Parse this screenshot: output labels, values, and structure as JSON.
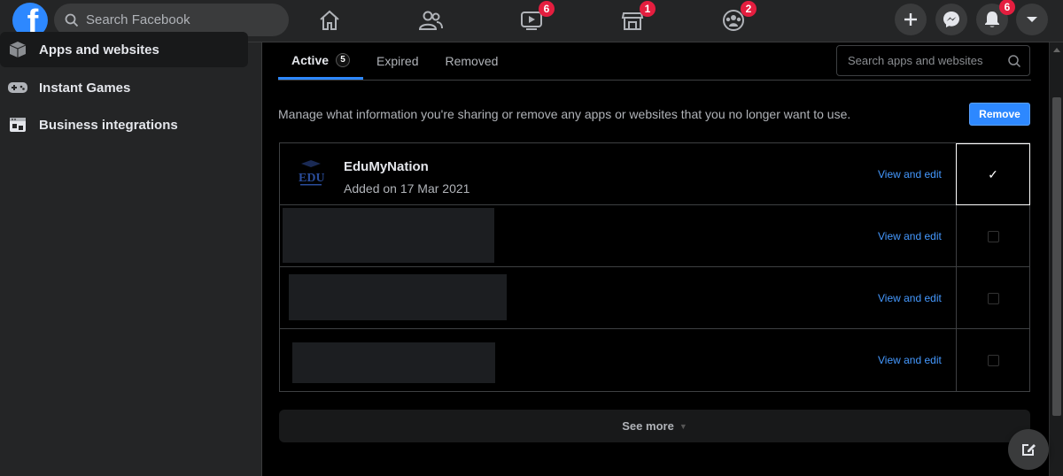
{
  "header": {
    "logo_letter": "f",
    "search_placeholder": "Search Facebook",
    "badges": {
      "watch": "6",
      "marketplace": "1",
      "groups": "2",
      "notifications": "6"
    },
    "accent_color": "#2d88ff",
    "badge_color": "#e41e3f"
  },
  "sidebar": {
    "items": [
      {
        "label": "Apps and websites",
        "icon": "cube-icon",
        "active": true
      },
      {
        "label": "Instant Games",
        "icon": "gamepad-icon",
        "active": false
      },
      {
        "label": "Business integrations",
        "icon": "business-integrations-icon",
        "active": false
      }
    ]
  },
  "main": {
    "tabs": [
      {
        "label": "Active",
        "count": "5",
        "active": true
      },
      {
        "label": "Expired"
      },
      {
        "label": "Removed"
      }
    ],
    "search_placeholder": "Search apps and websites",
    "description": "Manage what information you're sharing or remove any apps or websites that you no longer want to use.",
    "remove_label": "Remove",
    "apps": [
      {
        "name": "EduMyNation",
        "added": "Added on 17 Mar 2021",
        "logo_text": "EDU",
        "view_label": "View and edit",
        "selected": true
      },
      {
        "name": "",
        "added": "",
        "view_label": "View and edit",
        "selected": false,
        "redacted": true
      },
      {
        "name": "",
        "added": "",
        "view_label": "View and edit",
        "selected": false,
        "redacted": true
      },
      {
        "name": "",
        "added": "",
        "view_label": "View and edit",
        "selected": false,
        "redacted": true
      }
    ],
    "see_more_label": "See more"
  }
}
